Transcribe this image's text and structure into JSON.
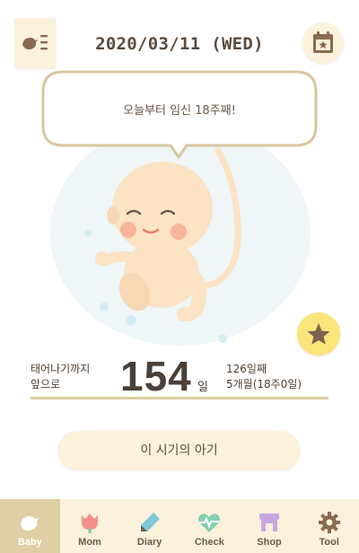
{
  "header": {
    "date": "2020/03/11 (WED)",
    "menu_icon": "menu-icon",
    "calendar_icon": "calendar-icon"
  },
  "bubble": {
    "message": "오늘부터 임신 18주째!"
  },
  "stats": {
    "left_line1": "태어나기까지",
    "left_line2": "앞으로",
    "days_left": "154",
    "unit": "일",
    "right_line1": "126일째",
    "right_line2": "5개월(18주0일)"
  },
  "cta_label": "이 시기의 아기",
  "tabs": [
    {
      "label": "Baby",
      "icon": "baby-icon",
      "active": true
    },
    {
      "label": "Mom",
      "icon": "tulip-icon",
      "active": false
    },
    {
      "label": "Diary",
      "icon": "pen-icon",
      "active": false
    },
    {
      "label": "Check",
      "icon": "heartbeat-icon",
      "active": false
    },
    {
      "label": "Shop",
      "icon": "shop-icon",
      "active": false
    },
    {
      "label": "Tool",
      "icon": "gear-icon",
      "active": false
    }
  ],
  "colors": {
    "accent": "#e0cfa5",
    "cream": "#fbf1dc",
    "star_button": "#fbe57a",
    "bubble_border": "#d8c7a0"
  }
}
